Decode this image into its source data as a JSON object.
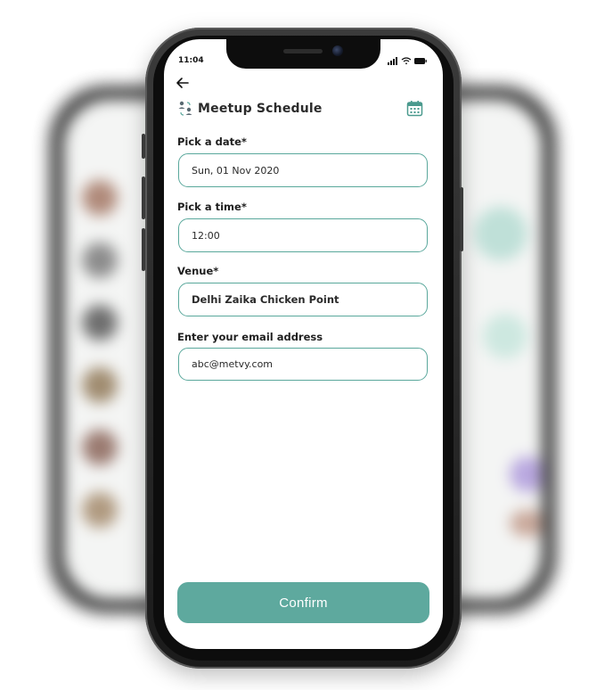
{
  "status_bar": {
    "time": "11:04"
  },
  "header": {
    "title": "Meetup Schedule",
    "back_icon": "arrow-left-icon",
    "title_icon": "people-swap-icon",
    "action_icon": "calendar-icon"
  },
  "form": {
    "date": {
      "label": "Pick a date*",
      "value": "Sun, 01 Nov 2020"
    },
    "time": {
      "label": "Pick a time*",
      "value": "12:00"
    },
    "venue": {
      "label": "Venue*",
      "value": "Delhi Zaika Chicken Point"
    },
    "email": {
      "label": "Enter your email address",
      "value": "abc@metvy.com"
    }
  },
  "confirm_label": "Confirm",
  "colors": {
    "accent": "#5ea99e",
    "field_border": "#5aa89c",
    "frame": "#1b1b1b"
  }
}
